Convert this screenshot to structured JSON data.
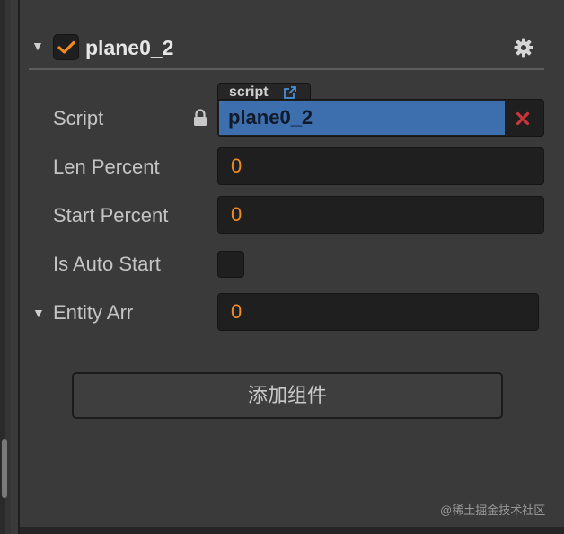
{
  "component": {
    "title": "plane0_2",
    "enabled": true
  },
  "properties": {
    "script": {
      "label": "Script",
      "tag": "script",
      "value": "plane0_2"
    },
    "len_percent": {
      "label": "Len Percent",
      "value": "0"
    },
    "start_percent": {
      "label": "Start Percent",
      "value": "0"
    },
    "is_auto_start": {
      "label": "Is Auto Start",
      "checked": false
    },
    "entity_arr": {
      "label": "Entity Arr",
      "value": "0"
    }
  },
  "add_component_label": "添加组件",
  "watermark": "@稀土掘金技术社区",
  "colors": {
    "accent_orange": "#f08c1f",
    "script_blue": "#3d6fae",
    "clear_red": "#c8363c",
    "panel_bg": "#3a3a3a",
    "field_bg": "#1f1f1f"
  },
  "icons": {
    "fold": "triangle-down-icon",
    "check": "checkmark-icon",
    "settings": "gear-icon",
    "lock": "lock-icon",
    "external": "external-link-icon",
    "clear": "x-icon"
  }
}
